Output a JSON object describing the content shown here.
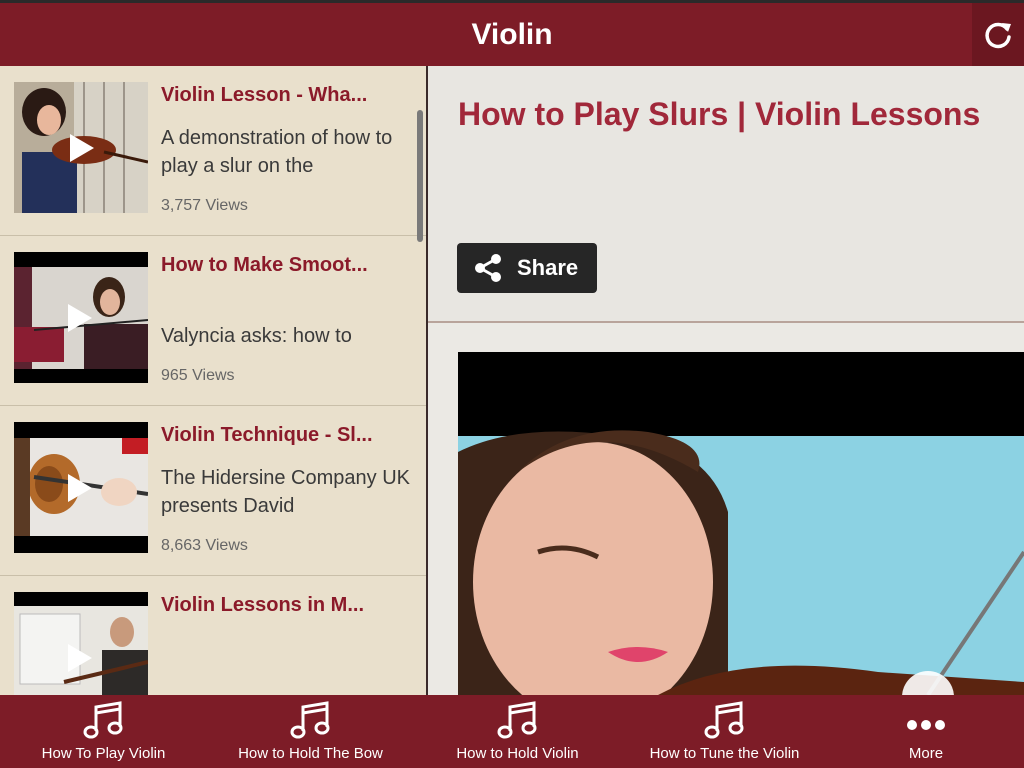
{
  "app": {
    "title": "Violin"
  },
  "list": [
    {
      "title": "Violin Lesson - Wha...",
      "desc": "A demonstration of how to play a slur on the",
      "views": "3,757 Views"
    },
    {
      "title": "How to Make Smoot...",
      "desc": "Valyncia asks: how to",
      "views": "965 Views"
    },
    {
      "title": "Violin Technique - Sl...",
      "desc": "The Hidersine Company UK presents David",
      "views": "8,663 Views"
    },
    {
      "title": "Violin Lessons in M...",
      "desc": "",
      "views": ""
    }
  ],
  "detail": {
    "title": "How to Play Slurs | Violin Lessons",
    "share_label": "Share"
  },
  "tabs": [
    {
      "label": "How To Play Violin",
      "icon": "music-note-icon"
    },
    {
      "label": "How to Hold The Bow",
      "icon": "music-note-icon"
    },
    {
      "label": "How to Hold Violin",
      "icon": "music-note-icon"
    },
    {
      "label": "How to Tune the Violin",
      "icon": "music-note-icon"
    },
    {
      "label": "More",
      "icon": "more-dots-icon"
    }
  ],
  "colors": {
    "brand": "#7d1c27",
    "title_red": "#8b1a2a",
    "list_bg": "#e9e0cc"
  }
}
